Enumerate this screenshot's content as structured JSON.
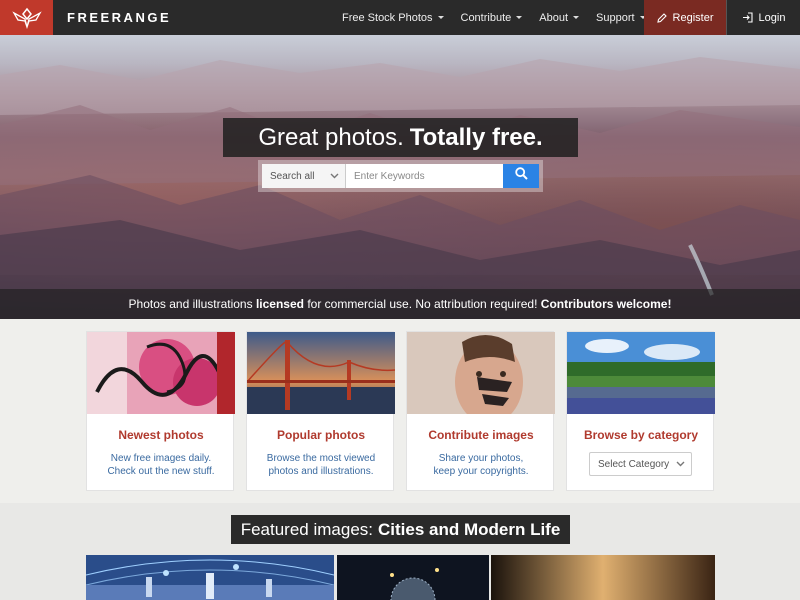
{
  "brand": {
    "name": "FREERANGE"
  },
  "nav": {
    "items": [
      {
        "label": "Free Stock Photos"
      },
      {
        "label": "Contribute"
      },
      {
        "label": "About"
      },
      {
        "label": "Support"
      }
    ],
    "register_label": "Register",
    "login_label": "Login"
  },
  "hero": {
    "title_plain": "Great photos.",
    "title_bold": "Totally free.",
    "search": {
      "scope": "Search all",
      "placeholder": "Enter Keywords"
    },
    "strip": {
      "t1": "Photos and illustrations",
      "b1": "licensed",
      "t2": "for commercial use. No attribution required!",
      "b2": "Contributors welcome!"
    }
  },
  "cards": [
    {
      "title": "Newest photos",
      "desc1": "New free images daily.",
      "desc2": "Check out the new stuff."
    },
    {
      "title": "Popular photos",
      "desc1": "Browse the most viewed",
      "desc2": "photos and illustrations."
    },
    {
      "title": "Contribute images",
      "desc1": "Share your photos,",
      "desc2": "keep your copyrights."
    },
    {
      "title": "Browse by category",
      "select": "Select Category"
    }
  ],
  "featured": {
    "label": "Featured images:",
    "topic": "Cities and Modern Life"
  },
  "colors": {
    "accent_red": "#c0392b",
    "nav_bg": "#2a2a2a",
    "search_blue": "#2a83e5",
    "card_title": "#b03a2e",
    "card_desc": "#3a6aa0"
  }
}
